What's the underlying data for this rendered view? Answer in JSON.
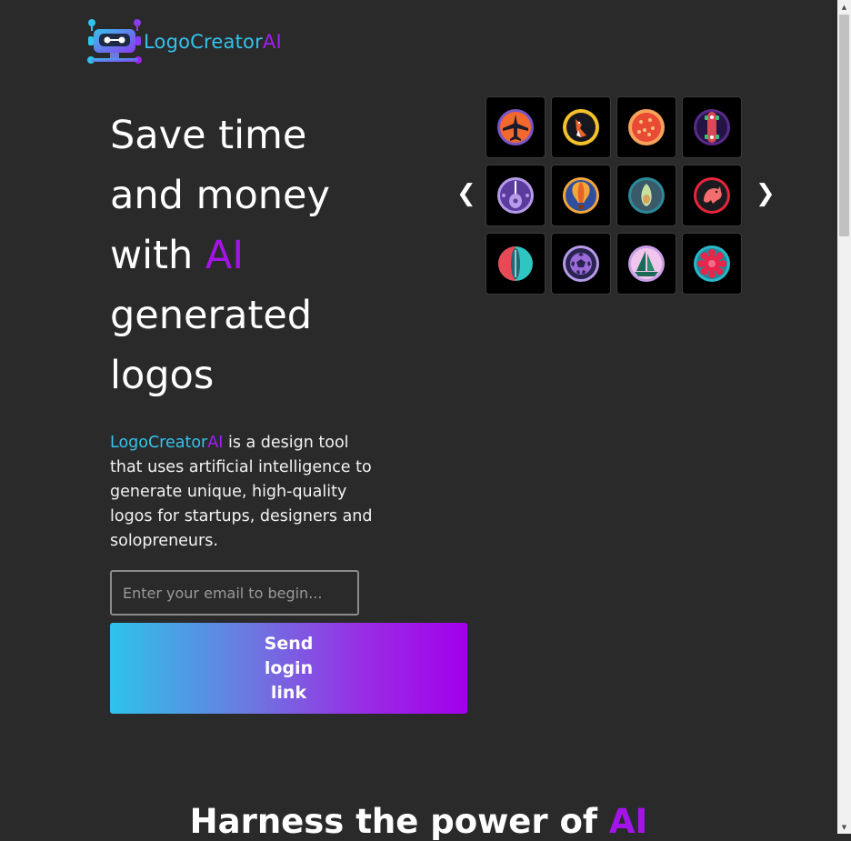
{
  "brand": {
    "name_part1": "LogoCreator",
    "name_part2": "AI"
  },
  "hero": {
    "title_line1": "Save time",
    "title_line2": "and money",
    "title_line3_pre": "with ",
    "title_line3_ai": "AI",
    "title_line4": "generated",
    "title_line5": "logos",
    "desc_brand1": "LogoCreator",
    "desc_brand2": "AI",
    "desc_rest": " is a design tool that uses artificial intelligence to generate unique, high-quality logos for startups, designers and solopreneurs."
  },
  "form": {
    "email_placeholder": "Enter your email to begin...",
    "email_value": "",
    "button_line1": "Send",
    "button_line2": "login",
    "button_line3": "link"
  },
  "carousel": {
    "prev_label": "❮",
    "next_label": "❯",
    "logos": [
      "airplane-logo-icon",
      "fox-logo-icon",
      "pizza-logo-icon",
      "skateboard-logo-icon",
      "guitar-logo-icon",
      "hot-air-balloon-logo-icon",
      "avocado-logo-icon",
      "dragon-logo-icon",
      "surfboard-logo-icon",
      "soccer-ball-logo-icon",
      "sailboat-logo-icon",
      "flower-logo-icon"
    ]
  },
  "section": {
    "title_pre": "Harness the power of ",
    "title_ai": "AI"
  },
  "colors": {
    "background": "#2a2a2b",
    "accent_cyan": "#35c2ec",
    "accent_purple": "#a414ea"
  }
}
